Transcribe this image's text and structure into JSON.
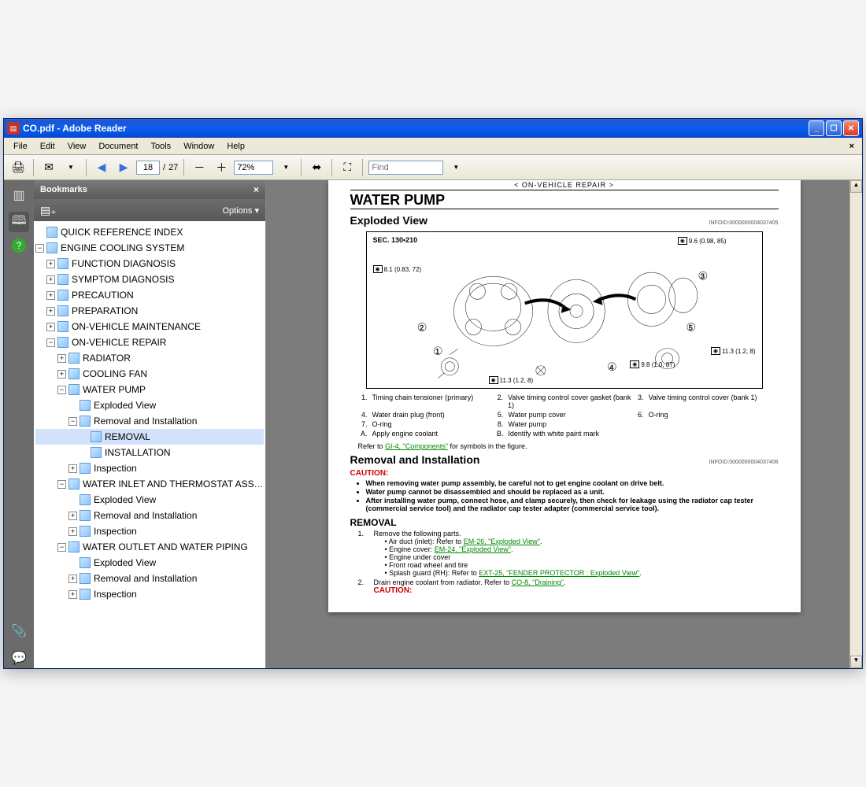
{
  "window": {
    "title": "CO.pdf - Adobe Reader"
  },
  "menubar": [
    "File",
    "Edit",
    "View",
    "Document",
    "Tools",
    "Window",
    "Help"
  ],
  "toolbar": {
    "page_current": "18",
    "page_total": "27",
    "zoom": "72%",
    "find_placeholder": "Find"
  },
  "bookmarks": {
    "title": "Bookmarks",
    "options": "Options",
    "tree": [
      {
        "level": 0,
        "exp": "",
        "label": "QUICK REFERENCE INDEX"
      },
      {
        "level": 0,
        "exp": "-",
        "label": "ENGINE COOLING SYSTEM"
      },
      {
        "level": 1,
        "exp": "+",
        "label": "FUNCTION DIAGNOSIS"
      },
      {
        "level": 1,
        "exp": "+",
        "label": "SYMPTOM DIAGNOSIS"
      },
      {
        "level": 1,
        "exp": "+",
        "label": "PRECAUTION"
      },
      {
        "level": 1,
        "exp": "+",
        "label": "PREPARATION"
      },
      {
        "level": 1,
        "exp": "+",
        "label": "ON-VEHICLE MAINTENANCE"
      },
      {
        "level": 1,
        "exp": "-",
        "label": "ON-VEHICLE REPAIR"
      },
      {
        "level": 2,
        "exp": "+",
        "label": "RADIATOR"
      },
      {
        "level": 2,
        "exp": "+",
        "label": "COOLING FAN"
      },
      {
        "level": 2,
        "exp": "-",
        "label": "WATER PUMP"
      },
      {
        "level": 3,
        "exp": "",
        "label": "Exploded View"
      },
      {
        "level": 3,
        "exp": "-",
        "label": "Removal and Installation"
      },
      {
        "level": 4,
        "exp": "",
        "label": "REMOVAL",
        "selected": true
      },
      {
        "level": 4,
        "exp": "",
        "label": "INSTALLATION"
      },
      {
        "level": 3,
        "exp": "+",
        "label": "Inspection"
      },
      {
        "level": 2,
        "exp": "-",
        "label": "WATER INLET AND THERMOSTAT ASSEMBLY"
      },
      {
        "level": 3,
        "exp": "",
        "label": "Exploded View"
      },
      {
        "level": 3,
        "exp": "+",
        "label": "Removal and Installation"
      },
      {
        "level": 3,
        "exp": "+",
        "label": "Inspection"
      },
      {
        "level": 2,
        "exp": "-",
        "label": "WATER OUTLET AND WATER PIPING"
      },
      {
        "level": 3,
        "exp": "",
        "label": "Exploded View"
      },
      {
        "level": 3,
        "exp": "+",
        "label": "Removal and Installation"
      },
      {
        "level": 3,
        "exp": "+",
        "label": "Inspection"
      }
    ]
  },
  "document": {
    "section_bar": "< ON-VEHICLE REPAIR >",
    "h1": "WATER PUMP",
    "h2_1": "Exploded View",
    "info1": "INFOID:0000000004037405",
    "diagram_sec": "SEC. 130•210",
    "callouts": {
      "c1": "8.1 (0.83, 72)",
      "c2": "9.6 (0.98, 85)",
      "c3": "11.3 (1.2, 8)",
      "c4": "9.8 (1.0, 87)",
      "c5": "11.3 (1.2, 8)"
    },
    "parts": [
      {
        "n": "1.",
        "t": "Timing chain tensioner (primary)"
      },
      {
        "n": "2.",
        "t": "Valve timing control cover gasket (bank 1)"
      },
      {
        "n": "3.",
        "t": "Valve timing control cover (bank 1)"
      },
      {
        "n": "4.",
        "t": "Water drain plug (front)"
      },
      {
        "n": "5.",
        "t": "Water pump cover"
      },
      {
        "n": "6.",
        "t": "O-ring"
      },
      {
        "n": "7.",
        "t": "O-ring"
      },
      {
        "n": "8.",
        "t": "Water pump"
      },
      {
        "n": "",
        "t": ""
      },
      {
        "n": "A.",
        "t": "Apply engine coolant"
      },
      {
        "n": "B.",
        "t": "Identify with white paint mark"
      },
      {
        "n": "",
        "t": ""
      }
    ],
    "refer1_prefix": "Refer to ",
    "refer1_link": "GI-4, \"Components\"",
    "refer1_suffix": " for symbols in the figure.",
    "h2_2": "Removal and Installation",
    "info2": "INFOID:0000000004037406",
    "caution": "CAUTION:",
    "caution_items": [
      "When removing water pump assembly, be careful not to get engine coolant on drive belt.",
      "Water pump cannot be disassembled and should be replaced as a unit.",
      "After installing water pump, connect hose, and clamp securely, then check for leakage using the radiator cap tester (commercial service tool) and the radiator cap tester adapter (commercial service tool)."
    ],
    "h3": "REMOVAL",
    "step1_text": "Remove the following parts.",
    "step1_subs": [
      {
        "t": "Air duct (inlet): Refer to ",
        "link": "EM-26, \"Exploded View\"",
        "suffix": "."
      },
      {
        "t": "Engine cover: ",
        "link": "EM-24, \"Exploded View\"",
        "suffix": "."
      },
      {
        "t": "Engine under cover"
      },
      {
        "t": "Front road wheel and tire"
      },
      {
        "t": "Splash guard (RH): Refer to ",
        "link": "EXT-25, \"FENDER PROTECTOR : Exploded View\"",
        "suffix": "."
      }
    ],
    "step2_text": "Drain engine coolant from radiator. Refer to ",
    "step2_link": "CO-8, \"Draining\"",
    "step2_suffix": ".",
    "caution2": "CAUTION:"
  }
}
